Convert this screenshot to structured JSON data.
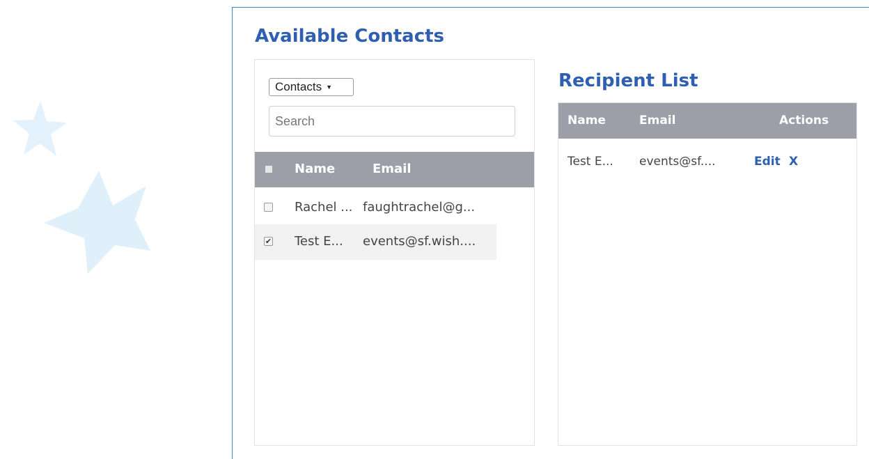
{
  "available": {
    "title": "Available Contacts",
    "filter_selected": "Contacts",
    "search_placeholder": "Search",
    "columns": {
      "name": "Name",
      "email": "Email"
    },
    "rows": [
      {
        "name": "Rachel ...",
        "email": "faughtrachel@g...",
        "checked": false
      },
      {
        "name": "Test E...",
        "email": "events@sf.wish....",
        "checked": true
      }
    ]
  },
  "recipients": {
    "title": "Recipient List",
    "columns": {
      "name": "Name",
      "email": "Email",
      "actions": "Actions"
    },
    "rows": [
      {
        "name": "Test E...",
        "email": "events@sf....",
        "edit": "Edit",
        "remove": "X"
      }
    ]
  },
  "colors": {
    "accent": "#2f5fb0",
    "header_bg": "#9d9fa8",
    "panel_border": "#3a87c8",
    "star": "#dff0fa"
  },
  "icons": {
    "decoration": "star-icon",
    "checkbox_checked": "✔"
  }
}
